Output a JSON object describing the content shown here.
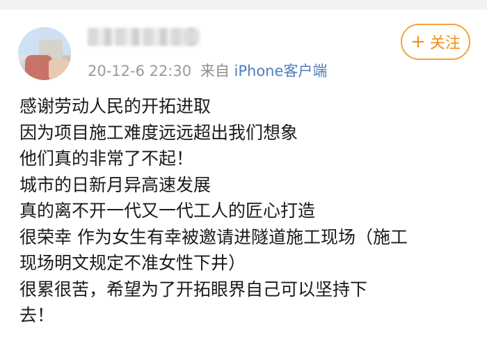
{
  "header": {
    "timestamp": "20-12-6 22:30",
    "source_prefix": "来自",
    "source_client": "iPhone客户端",
    "follow_button": {
      "icon": "plus-icon",
      "label": "关注"
    }
  },
  "post": {
    "lines": [
      "感谢劳动人民的开拓进取",
      "因为项目施工难度远远超出我们想象",
      "他们真的非常了不起！",
      "城市的日新月异高速发展",
      "真的离不开一代又一代工人的匠心打造",
      "很荣幸 作为女生有幸被邀请进隧道施工现场（施工",
      "现场明文规定不准女性下井）",
      "很累很苦，希望为了开拓眼界自己可以坚持下",
      "去！"
    ]
  },
  "colors": {
    "follow_accent": "#f08f1e",
    "client_link": "#4e7ebd",
    "meta_gray": "#9a9a9a"
  }
}
